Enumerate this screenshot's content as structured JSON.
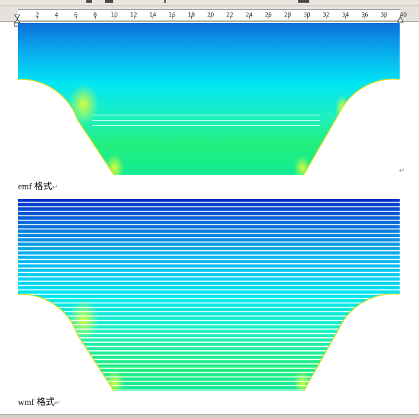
{
  "ruler": {
    "labels": [
      "2",
      "4",
      "6",
      "8",
      "10",
      "12",
      "14",
      "16",
      "18",
      "20",
      "22",
      "24",
      "26",
      "28",
      "30",
      "32",
      "34",
      "36",
      "38",
      "40"
    ]
  },
  "captions": {
    "emf": "emf 格式",
    "wmf": "wmf 格式"
  },
  "marks": {
    "return": "↵"
  },
  "colors": {
    "blue_top": "#0a6ad8",
    "cyan": "#00e8f0",
    "green": "#1df07a",
    "stripe": "#ffffff"
  }
}
